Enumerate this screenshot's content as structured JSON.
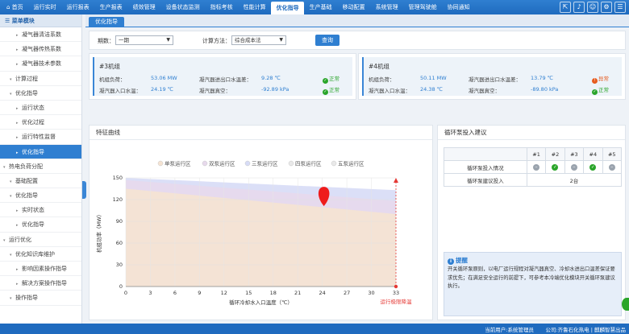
{
  "topnav": {
    "items": [
      "首页",
      "运行实时",
      "运行报表",
      "生产报表",
      "绩效管理",
      "设备状态监测",
      "指标考核",
      "性能计算",
      "优化指导",
      "生产基础",
      "移动配置",
      "系统管理",
      "管理驾驶舱",
      "协同通知"
    ],
    "active_index": 8,
    "icons": [
      "export-icon",
      "bell-icon",
      "user-icon",
      "gear-icon",
      "menu-icon"
    ]
  },
  "sidebar": {
    "header": "菜单模块",
    "rows": [
      {
        "label": "凝气器清洁系数",
        "level": 2
      },
      {
        "label": "凝气器传热系数",
        "level": 2
      },
      {
        "label": "凝气器技术参数",
        "level": 2
      },
      {
        "label": "计算过程",
        "level": 1
      },
      {
        "label": "优化指导",
        "level": 1
      },
      {
        "label": "运行状态",
        "level": 2
      },
      {
        "label": "优化过程",
        "level": 2
      },
      {
        "label": "运行特性监督",
        "level": 2
      },
      {
        "label": "优化指导",
        "level": 2,
        "active": true
      },
      {
        "label": "热电负荷分配",
        "level": 0
      },
      {
        "label": "基础配置",
        "level": 1
      },
      {
        "label": "优化指导",
        "level": 1
      },
      {
        "label": "实时状态",
        "level": 2
      },
      {
        "label": "优化指导",
        "level": 2
      },
      {
        "label": "运行优化",
        "level": 0
      },
      {
        "label": "优化知识库维护",
        "level": 1
      },
      {
        "label": "影响因素操作指导",
        "level": 2
      },
      {
        "label": "解决方案操作指导",
        "level": 2
      },
      {
        "label": "操作指导",
        "level": 1
      }
    ]
  },
  "tab": {
    "label": "优化指导"
  },
  "filter": {
    "period_label": "期数：",
    "period_value": "一期",
    "method_label": "计算方法：",
    "method_value": "综合成本法",
    "query_label": "查询"
  },
  "units": [
    {
      "title": "#3机组",
      "load_label": "机组负荷：",
      "load_value": "53.06 MW",
      "inlet_label": "凝汽器入口水温：",
      "inlet_value": "24.19 ℃",
      "outlet_label": "凝汽器进出口水温差：",
      "outlet_value": "9.28 ℃",
      "vacuum_label": "凝汽器真空：",
      "vacuum_value": "-92.89 kPa",
      "status1": "正常",
      "status1_type": "ok",
      "status2": "正常",
      "status2_type": "ok"
    },
    {
      "title": "#4机组",
      "load_label": "机组负荷：",
      "load_value": "50.11 MW",
      "inlet_label": "凝汽器入口水温：",
      "inlet_value": "24.38 ℃",
      "outlet_label": "凝汽器进出口水温差：",
      "outlet_value": "13.79 ℃",
      "vacuum_label": "凝汽器真空：",
      "vacuum_value": "-89.80 kPa",
      "status1": "异常",
      "status1_type": "bad",
      "status2": "正常",
      "status2_type": "ok"
    }
  ],
  "chart_panel": {
    "title": "特征曲线"
  },
  "chart_data": {
    "type": "area",
    "xlabel": "循环冷却水入口温度（℃）",
    "ylabel": "机组功率（MW）",
    "xlim": [
      0,
      33
    ],
    "ylim": [
      0,
      150
    ],
    "x_ticks": [
      0,
      3,
      6,
      9,
      12,
      15,
      18,
      21,
      24,
      27,
      30,
      33
    ],
    "y_ticks": [
      0,
      30,
      60,
      90,
      120,
      150
    ],
    "legend": [
      "单泵运行区",
      "双泵运行区",
      "三泵运行区",
      "四泵运行区",
      "五泵运行区"
    ],
    "legend_position": "top",
    "series": [
      {
        "name": "单泵运行区",
        "color": "#f5e3d2",
        "x": [
          0,
          33
        ],
        "y": [
          135,
          100
        ]
      },
      {
        "name": "双泵运行区",
        "color": "#e7d9ec",
        "x": [
          0,
          33
        ],
        "y": [
          147,
          118
        ]
      },
      {
        "name": "三泵运行区",
        "color": "#d7dcf6",
        "x": [
          0,
          33
        ],
        "y": [
          150,
          133
        ]
      }
    ],
    "current_point": {
      "x": 24.2,
      "y": 111,
      "color": "#ee1c1c"
    },
    "marker_line": {
      "x": 33,
      "label": "运行极限降温",
      "color": "#e53935"
    },
    "grid": true
  },
  "advice": {
    "title": "循环泵投入建议",
    "pumps": [
      "#1",
      "#2",
      "#3",
      "#4",
      "#5"
    ],
    "row1_label": "循环泵投入情况",
    "row1_status": [
      "neutral",
      "ok",
      "neutral",
      "ok",
      "neutral"
    ],
    "row2_label": "循环泵建议投入",
    "row2_value": "2台",
    "tips_title": "提醒",
    "tips_text": "开关循环泵原则，以电厂运行规程对凝汽器真空、冷却水进出口温差保证要求优先；在满足安全运行的前提下，可参考本冷端优化模块开关循环泵建议执行。"
  },
  "footer": {
    "user_text": "当前用户:系统管理员",
    "company_text": "公司:齐鲁石化热电 | 麒麟智慧出品"
  }
}
